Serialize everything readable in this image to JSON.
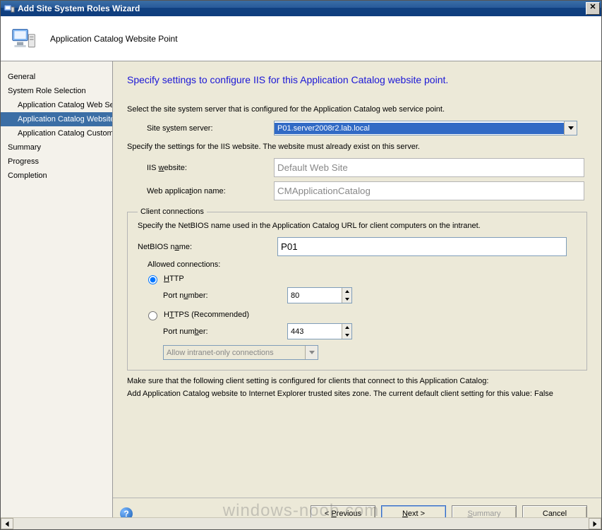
{
  "window": {
    "title": "Add Site System Roles Wizard",
    "close_glyph": "✕"
  },
  "banner": {
    "title": "Application Catalog Website Point"
  },
  "sidebar": {
    "items": [
      {
        "label": "General",
        "sub": false,
        "selected": false
      },
      {
        "label": "System Role Selection",
        "sub": false,
        "selected": false
      },
      {
        "label": "Application Catalog Web Se",
        "sub": true,
        "selected": false
      },
      {
        "label": "Application Catalog Website",
        "sub": true,
        "selected": true
      },
      {
        "label": "Application Catalog Customi",
        "sub": true,
        "selected": false
      },
      {
        "label": "Summary",
        "sub": false,
        "selected": false
      },
      {
        "label": "Progress",
        "sub": false,
        "selected": false
      },
      {
        "label": "Completion",
        "sub": false,
        "selected": false
      }
    ]
  },
  "main": {
    "heading": "Specify settings to configure IIS for this Application Catalog website point.",
    "instruction1": "Select the site system server that is configured for the Application Catalog web service point.",
    "site_system_label_pre": "Site s",
    "site_system_label_u": "y",
    "site_system_label_post": "stem server:",
    "site_system_value": "P01.server2008r2.lab.local",
    "instruction2": "Specify the settings for the IIS website. The website must already exist on this server.",
    "iis_label_pre": "IIS ",
    "iis_label_u": "w",
    "iis_label_post": "ebsite:",
    "iis_value": "Default Web Site",
    "webapp_label_pre": "Web applica",
    "webapp_label_u": "t",
    "webapp_label_post": "ion name:",
    "webapp_value": "CMApplicationCatalog",
    "fieldset_legend": "Client connections",
    "client_instruction": "Specify the NetBIOS name used in the Application Catalog URL for client computers on the intranet.",
    "netbios_label_pre": "NetBIOS n",
    "netbios_label_u": "a",
    "netbios_label_post": "me:",
    "netbios_value": "P01",
    "allowed_label": "Allowed connections:",
    "http_label_u": "H",
    "http_label_post": "TTP",
    "https_label_pre": "H",
    "https_label_u": "T",
    "https_label_post": "TPS (Recommended)",
    "port_label_pre": "Port n",
    "port_label_u": "u",
    "port_label_post": "mber:",
    "port_label2_pre": "Port num",
    "port_label2_u": "b",
    "port_label2_post": "er:",
    "http_port": "80",
    "https_port": "443",
    "intranet_option": "Allow intranet-only connections",
    "footnote1": "Make sure that the following client setting is configured for clients that connect to this Application Catalog:",
    "footnote2": "Add Application Catalog website to Internet Explorer trusted sites zone. The current default client setting for this value: False"
  },
  "footer": {
    "previous_pre": "< ",
    "previous_u": "P",
    "previous_post": "revious",
    "next_u": "N",
    "next_post": "ext >",
    "summary_u": "S",
    "summary_post": "ummary",
    "cancel": "Cancel"
  },
  "watermark": "windows-noob.com"
}
